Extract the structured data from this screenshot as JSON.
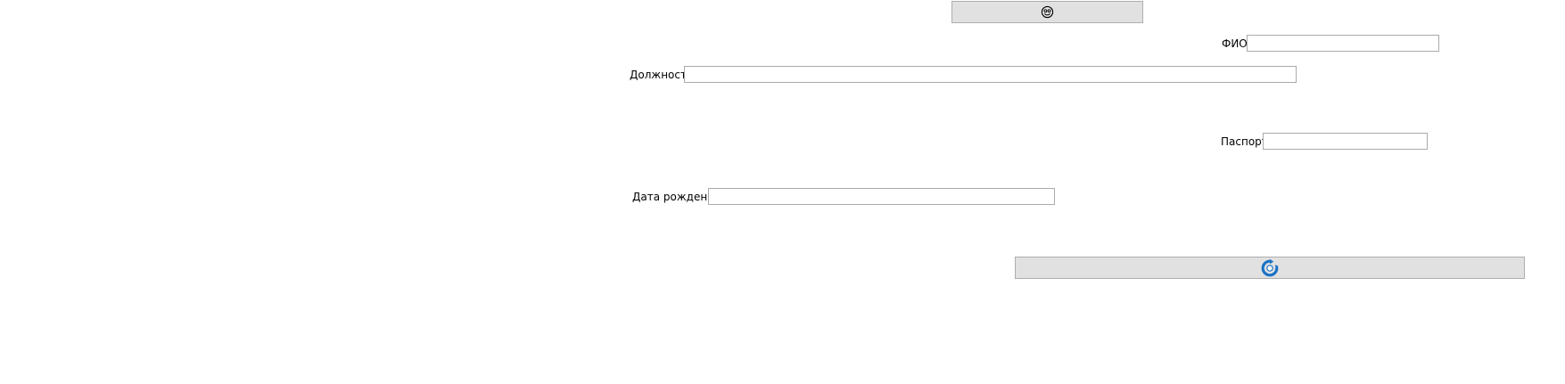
{
  "top_button": {
    "icon": "smiley-face-icon",
    "label": ""
  },
  "form": {
    "fio_label": "ФИО",
    "fio_value": "",
    "position_label": "Должность",
    "position_value": "",
    "passport_label": "Паспорт",
    "passport_value": "",
    "birthdate_label": "Дата рождения",
    "birthdate_value": ""
  },
  "bottom_button": {
    "icon": "refresh-icon",
    "label": "",
    "icon_color": "#1a73c7"
  }
}
